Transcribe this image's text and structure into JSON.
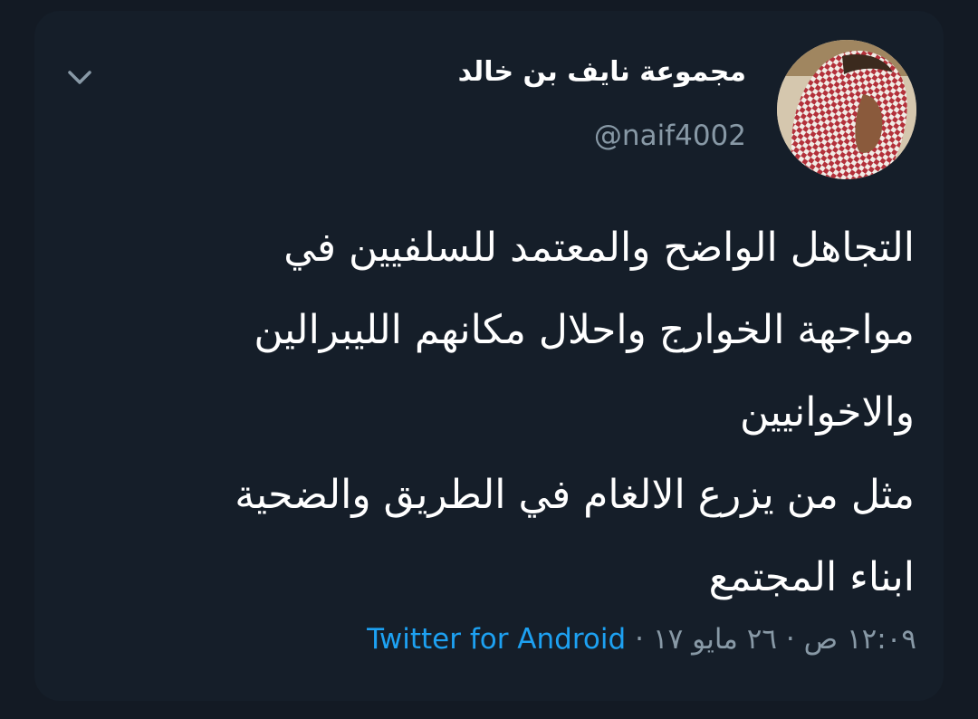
{
  "tweet": {
    "display_name": "مجموعة نايف بن خالد",
    "handle": "@naif4002",
    "body_lines": [
      "التجاهل الواضح والمعتمد للسلفيين في",
      "مواجهة الخوارج واحلال مكانهم الليبرالين",
      "والاخوانيين",
      "مثل من يزرع الالغام في الطريق والضحية",
      "ابناء المجتمع"
    ],
    "timestamp": "١٢:٠٩ ص · ٢٦ مايو ١٧",
    "separator": "·",
    "source": "Twitter for Android"
  },
  "icons": {
    "menu": "chevron-down-icon",
    "avatar": "avatar-image"
  },
  "colors": {
    "background": "#15202b",
    "text": "#ffffff",
    "secondary_text": "#8899a6",
    "link": "#1da1f2"
  }
}
